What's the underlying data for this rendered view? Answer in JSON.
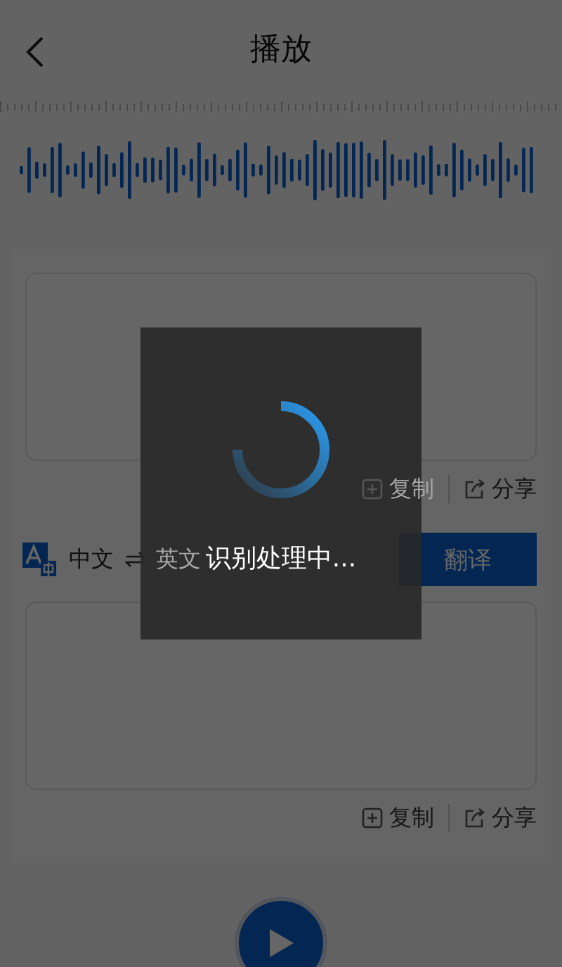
{
  "header": {
    "title": "播放"
  },
  "source_text": {
    "actions": [
      {
        "kind": "copy",
        "label": "复制"
      },
      {
        "kind": "share",
        "label": "分享"
      }
    ]
  },
  "language": {
    "from": "中文",
    "to": "英文"
  },
  "translate_button": {
    "label": "翻译"
  },
  "target_text": {
    "actions": [
      {
        "kind": "copy",
        "label": "复制"
      },
      {
        "kind": "share",
        "label": "分享"
      }
    ]
  },
  "loading": {
    "message": "识别处理中..."
  }
}
